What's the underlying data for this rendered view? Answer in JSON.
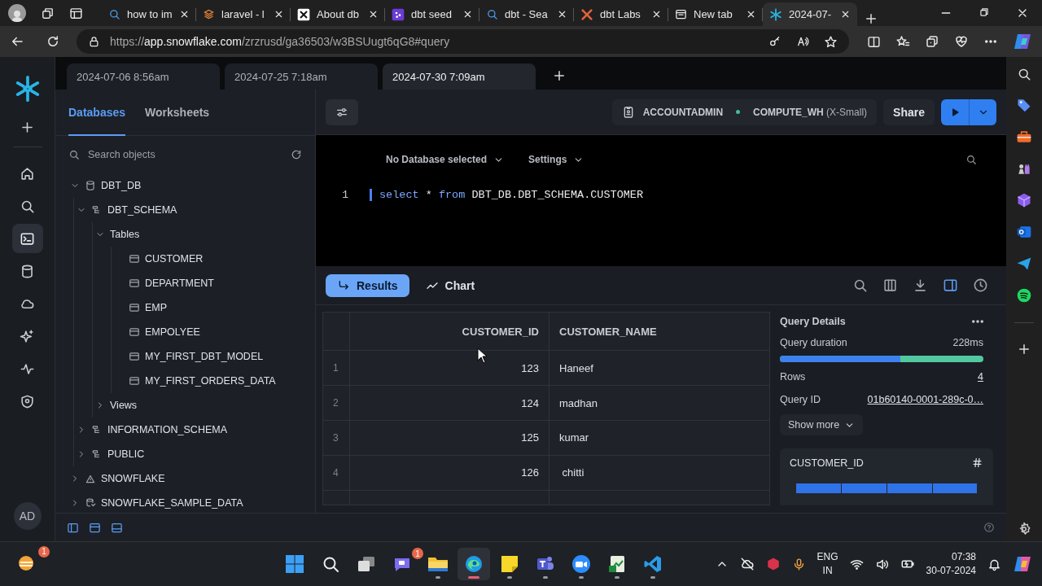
{
  "browser": {
    "tabs": [
      {
        "title": "how to im",
        "kind": "search",
        "selected": false
      },
      {
        "title": "laravel - l",
        "kind": "stack",
        "selected": false
      },
      {
        "title": "About db",
        "kind": "cross-tile",
        "selected": false
      },
      {
        "title": "dbt seed",
        "kind": "tile",
        "selected": false
      },
      {
        "title": "dbt - Sea",
        "kind": "search",
        "selected": false
      },
      {
        "title": "dbt Labs",
        "kind": "cross",
        "selected": false
      },
      {
        "title": "New tab",
        "kind": "newtab",
        "selected": false
      },
      {
        "title": "2024-07-",
        "kind": "snowflake",
        "selected": true
      }
    ],
    "url": {
      "scheme": "https://",
      "host": "app.snowflake.com",
      "path": "/zrzrusd/ga36503/w3BSUugt6qG8#query"
    }
  },
  "worksheet_tabs": [
    {
      "label": "2024-07-06 8:56am",
      "selected": false
    },
    {
      "label": "2024-07-25 7:18am",
      "selected": false
    },
    {
      "label": "2024-07-30 7:09am",
      "selected": true
    }
  ],
  "nav": {
    "items": [
      {
        "kind": "create",
        "selected": false
      },
      {
        "kind": "home",
        "selected": false
      },
      {
        "kind": "search",
        "selected": false
      },
      {
        "kind": "worksheets",
        "selected": true
      },
      {
        "kind": "data",
        "selected": false
      },
      {
        "kind": "cloud",
        "selected": false
      },
      {
        "kind": "ai",
        "selected": false
      },
      {
        "kind": "monitoring",
        "selected": false
      },
      {
        "kind": "admin",
        "selected": false
      }
    ],
    "avatar": "AD"
  },
  "explorer": {
    "tabs": [
      {
        "label": "Databases",
        "selected": true
      },
      {
        "label": "Worksheets",
        "selected": false
      }
    ],
    "search": {
      "placeholder": "Search objects"
    },
    "tree": [
      {
        "label": "DBT_DB",
        "kind": "database",
        "expanded": true,
        "children": [
          {
            "label": "DBT_SCHEMA",
            "kind": "schema",
            "expanded": true,
            "children": [
              {
                "label": "Tables",
                "expanded": true,
                "children": [
                  {
                    "label": "CUSTOMER",
                    "kind": "table"
                  },
                  {
                    "label": "DEPARTMENT",
                    "kind": "table"
                  },
                  {
                    "label": "EMP",
                    "kind": "table"
                  },
                  {
                    "label": "EMPOLYEE",
                    "kind": "table"
                  },
                  {
                    "label": "MY_FIRST_DBT_MODEL",
                    "kind": "table"
                  },
                  {
                    "label": "MY_FIRST_ORDERS_DATA",
                    "kind": "table"
                  }
                ]
              },
              {
                "label": "Views",
                "expanded": false
              }
            ]
          },
          {
            "label": "INFORMATION_SCHEMA",
            "kind": "schema",
            "expanded": false
          },
          {
            "label": "PUBLIC",
            "kind": "schema",
            "expanded": false
          }
        ]
      },
      {
        "label": "SNOWFLAKE",
        "kind": "shared_database",
        "expanded": false
      },
      {
        "label": "SNOWFLAKE_SAMPLE_DATA",
        "kind": "sample_database",
        "expanded": false
      }
    ]
  },
  "worksheet": {
    "role": "ACCOUNTADMIN",
    "warehouse": "COMPUTE_WH",
    "warehouse_size": "(X-Small)",
    "share": "Share",
    "database_selector": "No Database selected",
    "settings": "Settings",
    "lines": [
      {
        "number": "1",
        "tokens": [
          {
            "text": "select",
            "kind": "keyword"
          },
          {
            "text": " * ",
            "kind": "plain"
          },
          {
            "text": "from",
            "kind": "keyword"
          },
          {
            "text": " DBT_DB.DBT_SCHEMA.CUSTOMER",
            "kind": "plain"
          }
        ]
      }
    ]
  },
  "results": {
    "tabs": [
      {
        "label": "Results",
        "kind": "results",
        "selected": true
      },
      {
        "label": "Chart",
        "kind": "chart",
        "selected": false
      }
    ],
    "toolbar": [
      {
        "kind": "search",
        "selected": false
      },
      {
        "kind": "columns",
        "selected": false
      },
      {
        "kind": "download",
        "selected": false
      },
      {
        "kind": "details",
        "selected": true
      },
      {
        "kind": "history",
        "selected": false
      }
    ],
    "table": {
      "columns": [
        "CUSTOMER_ID",
        "CUSTOMER_NAME"
      ],
      "rows": [
        {
          "index": "1",
          "cells": [
            "123",
            "Haneef"
          ]
        },
        {
          "index": "2",
          "cells": [
            "124",
            "madhan"
          ]
        },
        {
          "index": "3",
          "cells": [
            "125",
            "kumar"
          ]
        },
        {
          "index": "4",
          "cells": [
            "126",
            " chitti"
          ]
        }
      ]
    },
    "query_details": {
      "title": "Query Details",
      "duration": {
        "label": "Query duration",
        "value": "228ms",
        "level": 0.59
      },
      "rows": {
        "label": "Rows",
        "value": "4"
      },
      "query_id": {
        "label": "Query ID",
        "value": "01b60140-0001-289c-0…"
      },
      "show_more": "Show more"
    },
    "column_card": {
      "title": "CUSTOMER_ID"
    }
  },
  "taskbar": {
    "weather": {
      "badge": "1"
    },
    "apps": [
      {
        "kind": "start",
        "running": false,
        "active": false
      },
      {
        "kind": "search",
        "running": false,
        "active": false
      },
      {
        "kind": "task_view",
        "running": false,
        "active": false
      },
      {
        "kind": "chat",
        "running": false,
        "active": false,
        "badge": "1"
      },
      {
        "kind": "files",
        "running": true,
        "active": false
      },
      {
        "kind": "browser",
        "running": true,
        "active": true
      },
      {
        "kind": "notes",
        "running": true,
        "active": false
      },
      {
        "kind": "teams",
        "running": true,
        "active": false
      },
      {
        "kind": "meetings",
        "running": true,
        "active": false
      },
      {
        "kind": "sheet",
        "running": true,
        "active": false
      },
      {
        "kind": "code",
        "running": true,
        "active": false
      }
    ],
    "tray": {
      "language": "ENG",
      "region": "IN",
      "time": "07:38",
      "date": "30-07-2024"
    }
  }
}
